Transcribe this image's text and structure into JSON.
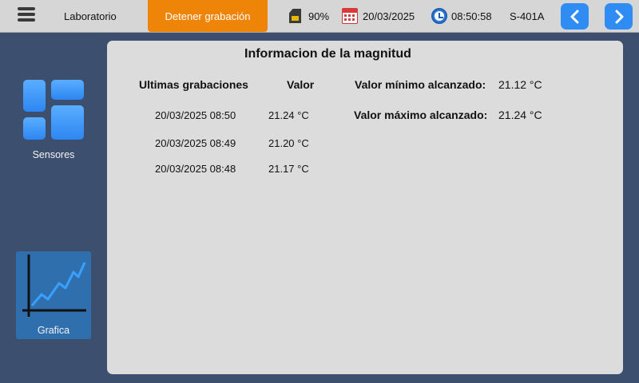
{
  "header": {
    "location": "Laboratorio",
    "record_button": "Detener grabación",
    "storage": "90%",
    "date": "20/03/2025",
    "time": "08:50:58",
    "device": "S-401A"
  },
  "sidebar": {
    "items": [
      {
        "label": "Sensores",
        "icon": "grid-icon"
      },
      {
        "label": "Grafica",
        "icon": "chart-icon",
        "active": true
      }
    ]
  },
  "main": {
    "title": "Informacion de la magnitud",
    "col_recordings": "Ultimas grabaciones",
    "col_value": "Valor",
    "recordings": [
      {
        "timestamp": "20/03/2025 08:50",
        "value": "21.24 °C"
      },
      {
        "timestamp": "20/03/2025 08:49",
        "value": "21.20 °C"
      },
      {
        "timestamp": "20/03/2025 08:48",
        "value": "21.17 °C"
      }
    ],
    "min_label": "Valor mínimo alcanzado:",
    "min_value": "21.12 °C",
    "max_label": "Valor máximo alcanzado:",
    "max_value": "21.24 °C"
  },
  "colors": {
    "background": "#3d4f6f",
    "topbar": "#d6d6d6",
    "record_button": "#ee8408",
    "nav_button": "#2e8cf2",
    "active_tab": "#2f6fad",
    "panel": "#dcdcdc"
  }
}
